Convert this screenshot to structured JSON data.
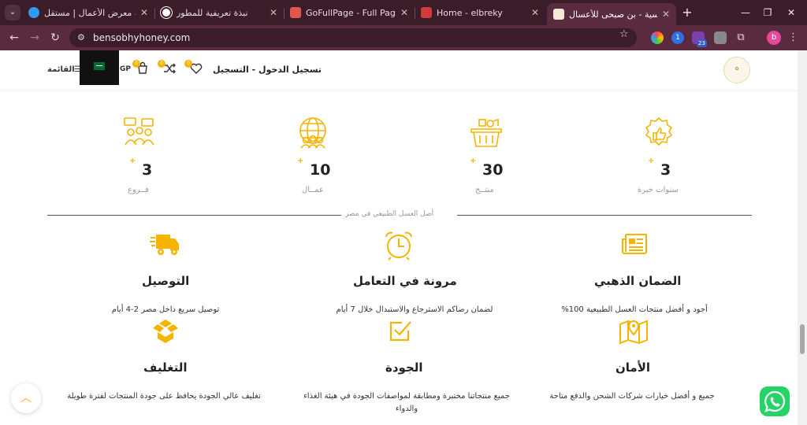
{
  "browser": {
    "tabs": [
      {
        "label": "إضافة معرض الأعمال | مستقل",
        "favicon_color": "#2e9bf0"
      },
      {
        "label": "نبذة تعريفية للمطور",
        "favicon_color": "#ffffff"
      },
      {
        "label": "GoFullPage - Full Page Scree",
        "favicon_color": "#e2574c"
      },
      {
        "label": "Home - elbreky",
        "favicon_color": "#d23b3b"
      },
      {
        "label": "الرئيسية - بن صبحى للأعسال",
        "favicon_color": "#f3e9d6",
        "active": true
      }
    ],
    "url": "bensobhyhoney.com",
    "extension_badge": "23",
    "profile_initial": "b"
  },
  "header": {
    "menu_label": "القائمة",
    "currency": "GP",
    "cart_count": "0",
    "compare_count": "0",
    "wishlist_count": "0",
    "login_label": "تسجيل الدخول - التسجيل"
  },
  "stats": [
    {
      "value": "3",
      "plus": "+",
      "label": "فــروع",
      "icon": "people-chat-icon"
    },
    {
      "value": "10",
      "plus": "+",
      "label": "عمــال",
      "icon": "globe-team-icon"
    },
    {
      "value": "30",
      "plus": "+",
      "label": "منتــج",
      "icon": "basket-icon"
    },
    {
      "value": "3",
      "plus": "+",
      "label": "سنوات خبرة",
      "icon": "like-badge-icon"
    }
  ],
  "divider_text": "أصل العسل الطبيعي في مصر",
  "features": [
    {
      "title": "التوصيل",
      "text": "توصيل سريع داخل مصر 2-4 أيام",
      "icon": "truck-icon"
    },
    {
      "title": "مرونة في التعامل",
      "text": "لضمان رضاكم الاسترجاع والاستبدال خلال 7 أيام",
      "icon": "clock-icon"
    },
    {
      "title": "الضمان الذهبي",
      "text": "أجود و أفضل منتجات العسل الطبيعية 100%",
      "icon": "newspaper-icon"
    },
    {
      "title": "التغليف",
      "text": "تغليف عالي الجودة يحافظ على جودة المنتجات لفترة طويلة",
      "icon": "box-icon"
    },
    {
      "title": "الجودة",
      "text": "جميع منتجاتنا مختبرة ومطابقة لمواصفات الجودة في هيئة الغذاء والدواء",
      "icon": "check-square-icon"
    },
    {
      "title": "الأمان",
      "text": "جميع و أفضل خيارات شركات الشحن والدفع متاحة",
      "icon": "map-pin-icon"
    }
  ],
  "colors": {
    "accent": "#f5b400",
    "browser_frame": "#3b1d2a",
    "whatsapp": "#25d366"
  }
}
